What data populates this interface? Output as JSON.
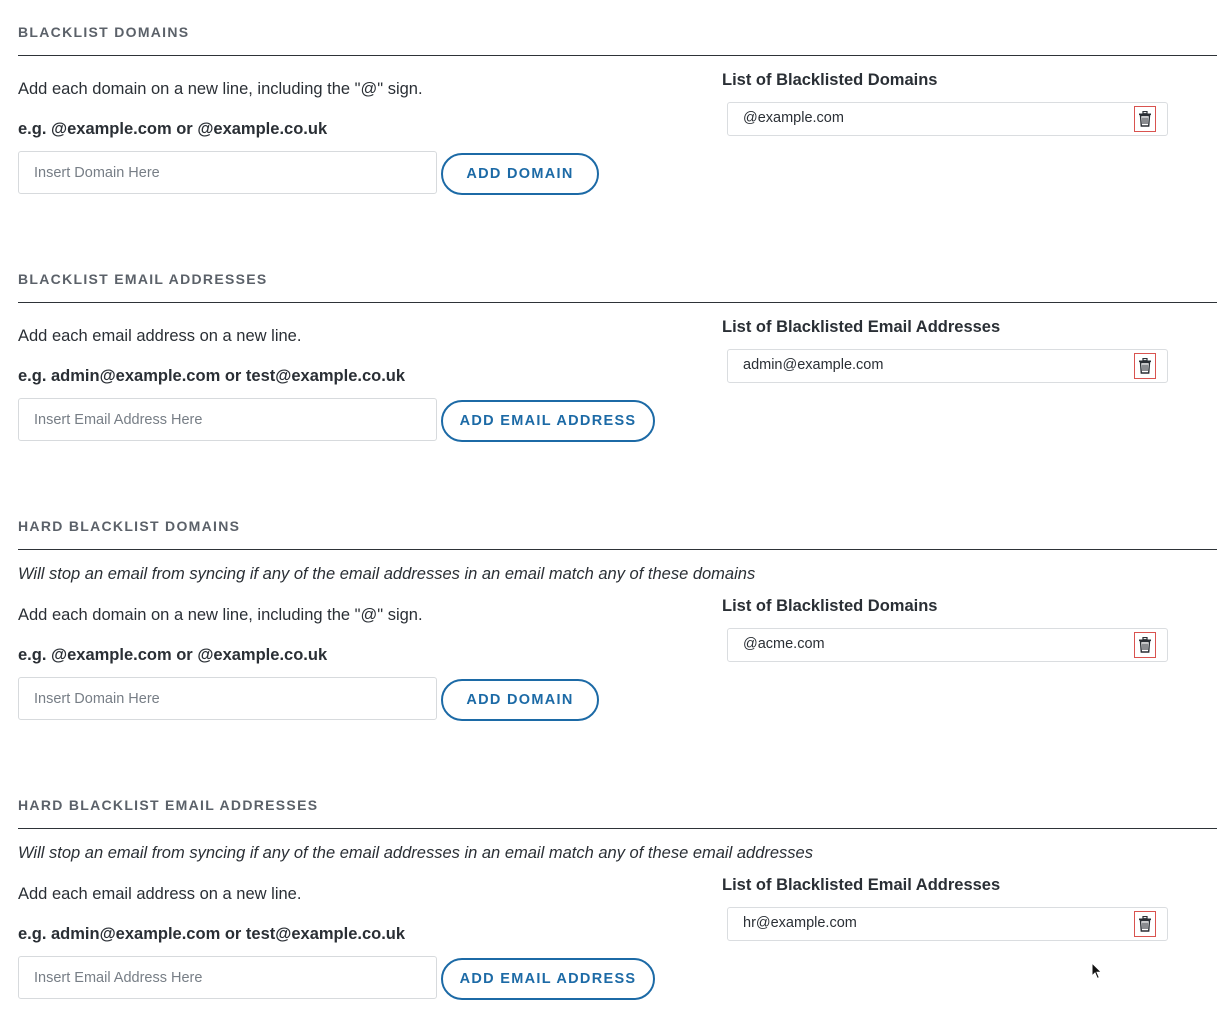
{
  "sections": [
    {
      "title": "BLACKLIST DOMAINS",
      "instruction": "Add each domain on a new line, including the \"@\" sign.",
      "example": "e.g. @example.com or @example.co.uk",
      "input_placeholder": "Insert Domain Here",
      "button_label": "ADD DOMAIN",
      "list_heading": "List of Blacklisted Domains",
      "list_items": [
        "@example.com"
      ]
    },
    {
      "title": "BLACKLIST EMAIL ADDRESSES",
      "instruction": "Add each email address on a new line.",
      "example": "e.g. admin@example.com or test@example.co.uk",
      "input_placeholder": "Insert Email Address Here",
      "button_label": "ADD EMAIL ADDRESS",
      "list_heading": "List of Blacklisted Email Addresses",
      "list_items": [
        "admin@example.com"
      ]
    },
    {
      "title": "HARD BLACKLIST DOMAINS",
      "note": "Will stop an email from syncing if any of the email addresses in an email match any of these domains",
      "instruction": "Add each domain on a new line, including the \"@\" sign.",
      "example": "e.g. @example.com or @example.co.uk",
      "input_placeholder": "Insert Domain Here",
      "button_label": "ADD DOMAIN",
      "list_heading": "List of Blacklisted Domains",
      "list_items": [
        "@acme.com"
      ]
    },
    {
      "title": "HARD BLACKLIST EMAIL ADDRESSES",
      "note": "Will stop an email from syncing if any of the email addresses in an email match any of these email addresses",
      "instruction": "Add each email address on a new line.",
      "example": "e.g. admin@example.com or test@example.co.uk",
      "input_placeholder": "Insert Email Address Here",
      "button_label": "ADD EMAIL ADDRESS",
      "list_heading": "List of Blacklisted Email Addresses",
      "list_items": [
        "hr@example.com"
      ]
    }
  ],
  "icons": {
    "delete": "trash-icon",
    "pointer": "mouse-cursor-icon"
  },
  "colors": {
    "accent": "#1c6aa6",
    "delete_border": "#d9534f",
    "text": "#2a2f35",
    "section_title": "#5b6169"
  }
}
